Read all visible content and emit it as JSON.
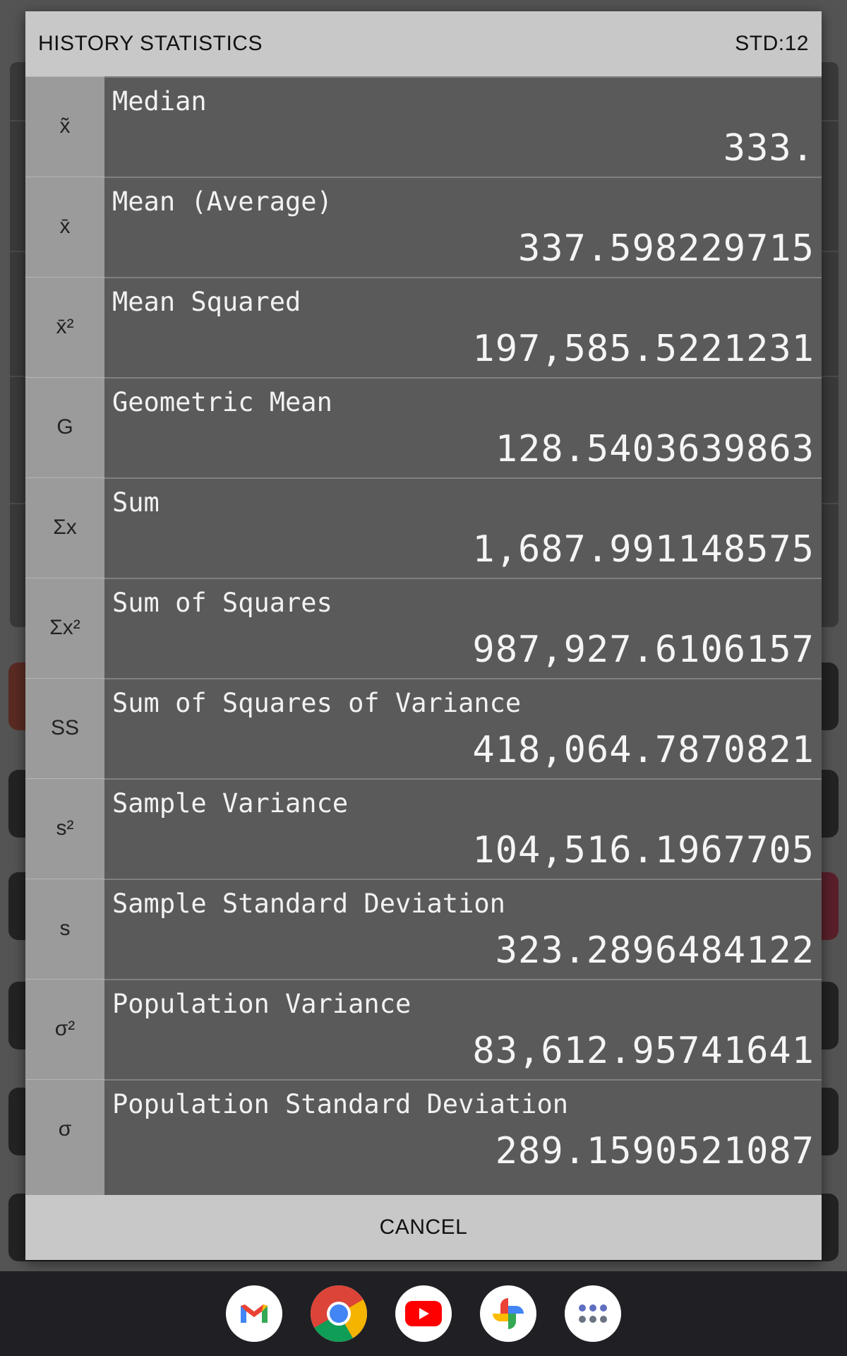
{
  "dialog": {
    "title": "HISTORY STATISTICS",
    "badge": "STD:12",
    "cancel_label": "CANCEL"
  },
  "stats": [
    {
      "symbol": "x̃",
      "label": "Median",
      "value": "333."
    },
    {
      "symbol": "x̄",
      "label": "Mean (Average)",
      "value": "337.598229715"
    },
    {
      "symbol": "x̄²",
      "label": "Mean Squared",
      "value": "197,585.5221231"
    },
    {
      "symbol": "G",
      "label": "Geometric Mean",
      "value": "128.5403639863"
    },
    {
      "symbol": "Σx",
      "label": "Sum",
      "value": "1,687.991148575"
    },
    {
      "symbol": "Σx²",
      "label": "Sum of Squares",
      "value": "987,927.6106157"
    },
    {
      "symbol": "SS",
      "label": "Sum of Squares of Variance",
      "value": "418,064.7870821"
    },
    {
      "symbol": "s²",
      "label": "Sample Variance",
      "value": "104,516.1967705"
    },
    {
      "symbol": "s",
      "label": "Sample Standard Deviation",
      "value": "323.2896484122"
    },
    {
      "symbol": "σ²",
      "label": "Population Variance",
      "value": "83,612.95741641"
    },
    {
      "symbol": "σ",
      "label": "Population Standard Deviation",
      "value": "289.1590521087"
    }
  ],
  "dock": {
    "apps": [
      {
        "icon": "gmail-icon",
        "color": "#ea4335"
      },
      {
        "icon": "chrome-icon",
        "color": "#4285f4"
      },
      {
        "icon": "youtube-icon",
        "color": "#ff0000"
      },
      {
        "icon": "photos-icon",
        "color": "#fbbc04"
      },
      {
        "icon": "app-drawer-icon",
        "color": "#5f6368"
      }
    ]
  }
}
